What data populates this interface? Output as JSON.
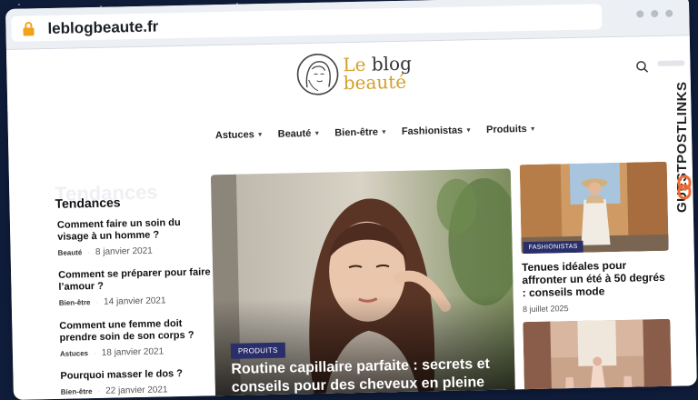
{
  "browser": {
    "url": "leblogbeaute.fr"
  },
  "site": {
    "logo": {
      "line1_a": "Le",
      "line1_b": "blog",
      "line2": "beauté"
    },
    "nav": [
      {
        "label": "Astuces"
      },
      {
        "label": "Beauté"
      },
      {
        "label": "Bien-être"
      },
      {
        "label": "Fashionistas"
      },
      {
        "label": "Produits"
      }
    ]
  },
  "sidebar": {
    "heading": "Tendances",
    "heading_ghost": "Tendances",
    "items": [
      {
        "title": "Comment faire un soin du visage à un homme ?",
        "category": "Beauté",
        "date": "8 janvier 2021"
      },
      {
        "title": "Comment se préparer pour faire l’amour ?",
        "category": "Bien-être",
        "date": "14 janvier 2021"
      },
      {
        "title": "Comment une femme doit prendre soin de son corps ?",
        "category": "Astuces",
        "date": "18 janvier 2021"
      },
      {
        "title": "Pourquoi masser le dos ?",
        "category": "Bien-être",
        "date": "22 janvier 2021"
      }
    ]
  },
  "hero": {
    "category": "PRODUITS",
    "title": "Routine capillaire parfaite : secrets et conseils pour des cheveux en pleine"
  },
  "side_cards": [
    {
      "category": "FASHIONISTAS",
      "title": "Tenues idéales pour affronter un été à 50 degrés : conseils mode",
      "date": "8 juillet 2025"
    },
    {
      "category": "",
      "title": "",
      "date": ""
    }
  ],
  "watermark": {
    "text": "GUESTPOSTLINKS"
  },
  "colors": {
    "badge": "#2a2f6b",
    "logo_gold": "#d2a02c",
    "backdrop": "#0f1d3b"
  }
}
